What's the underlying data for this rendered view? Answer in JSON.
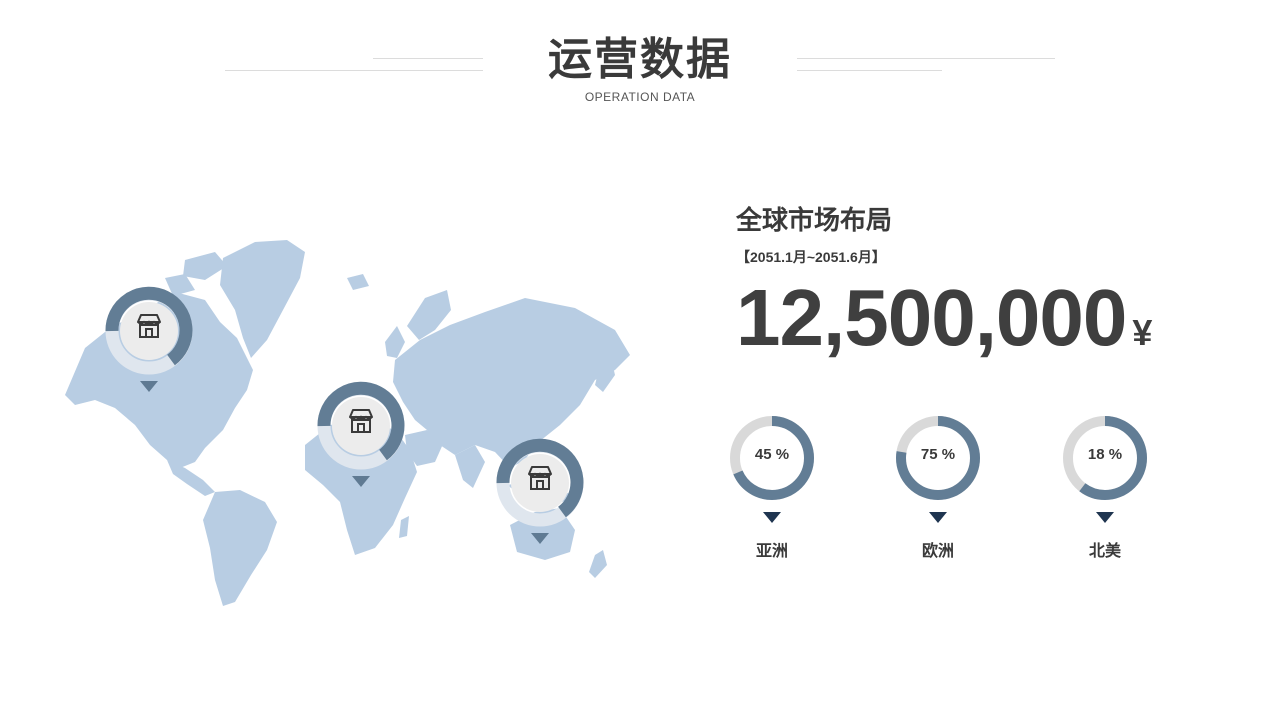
{
  "header": {
    "title": "运营数据",
    "subtitle": "OPERATION DATA"
  },
  "market": {
    "title": "全球市场布局",
    "period": "【2051.1月~2051.6月】",
    "amount": "12,500,000",
    "currency": "¥"
  },
  "regions": [
    {
      "name": "亚洲",
      "percent": 45,
      "label": "45 %"
    },
    {
      "name": "欧洲",
      "percent": 75,
      "label": "75 %"
    },
    {
      "name": "北美",
      "percent": 18,
      "label": "18 %"
    }
  ],
  "colors": {
    "accent": "#627d95",
    "track": "#d9d9d9",
    "map": "#b8cde3",
    "pin_dark": "#1f3550",
    "text": "#3a3a3a"
  },
  "map_markers": [
    {
      "region": "north-america",
      "icon": "store-icon"
    },
    {
      "region": "europe-africa",
      "icon": "store-icon"
    },
    {
      "region": "asia-oceania",
      "icon": "store-icon"
    }
  ]
}
